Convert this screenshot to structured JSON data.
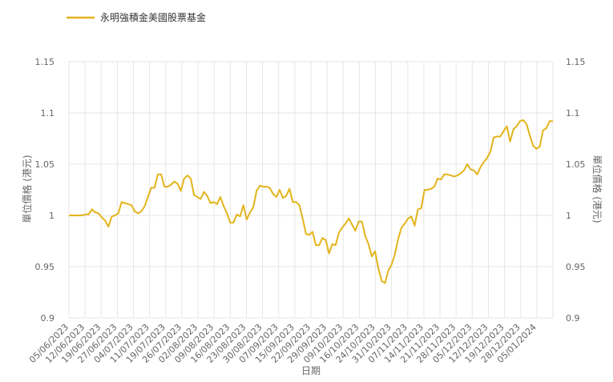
{
  "chart_data": {
    "type": "line",
    "title": "",
    "xlabel": "日期",
    "ylabel_left": "單位價格 (港元)",
    "ylabel_right": "單位價格 (港元)",
    "ylim": [
      0.9,
      1.15
    ],
    "yticks": [
      "0.9",
      "0.95",
      "1",
      "1.05",
      "1.1",
      "1.15"
    ],
    "grid": true,
    "legend_position": "top-left",
    "color": "#E3B41B",
    "x_tick_labels": [
      "05/06/2023",
      "12/06/2023",
      "19/06/2023",
      "27/06/2023",
      "04/07/2023",
      "11/07/2023",
      "19/07/2023",
      "26/07/2023",
      "02/08/2023",
      "09/08/2023",
      "16/08/2023",
      "23/08/2023",
      "30/08/2023",
      "07/09/2023",
      "15/09/2023",
      "22/09/2023",
      "29/09/2023",
      "09/10/2023",
      "16/10/2023",
      "24/10/2023",
      "31/10/2023",
      "07/11/2023",
      "14/11/2023",
      "21/11/2023",
      "28/11/2023",
      "05/12/2023",
      "12/12/2023",
      "19/12/2023",
      "28/12/2023",
      "05/01/2024"
    ],
    "series": [
      {
        "name": "永明強積金美國股票基金",
        "values": [
          1.0,
          1.0,
          1.0,
          1.0,
          1.0,
          1.001,
          1.001,
          1.006,
          1.003,
          1.002,
          0.998,
          0.995,
          0.989,
          0.999,
          1.0,
          1.002,
          1.013,
          1.012,
          1.011,
          1.01,
          1.004,
          1.002,
          1.004,
          1.009,
          1.018,
          1.027,
          1.027,
          1.04,
          1.04,
          1.028,
          1.028,
          1.03,
          1.033,
          1.031,
          1.024,
          1.036,
          1.039,
          1.036,
          1.02,
          1.018,
          1.016,
          1.023,
          1.019,
          1.012,
          1.013,
          1.011,
          1.018,
          1.009,
          1.002,
          0.993,
          0.993,
          1.001,
          0.999,
          1.01,
          0.996,
          1.003,
          1.008,
          1.024,
          1.029,
          1.028,
          1.028,
          1.027,
          1.021,
          1.018,
          1.025,
          1.017,
          1.019,
          1.026,
          1.013,
          1.013,
          1.01,
          0.997,
          0.982,
          0.981,
          0.984,
          0.971,
          0.971,
          0.978,
          0.976,
          0.963,
          0.972,
          0.971,
          0.983,
          0.988,
          0.992,
          0.997,
          0.991,
          0.985,
          0.994,
          0.994,
          0.98,
          0.972,
          0.96,
          0.965,
          0.948,
          0.936,
          0.934,
          0.946,
          0.952,
          0.962,
          0.977,
          0.988,
          0.992,
          0.997,
          0.999,
          0.99,
          1.006,
          1.007,
          1.025,
          1.025,
          1.026,
          1.028,
          1.036,
          1.035,
          1.04,
          1.04,
          1.039,
          1.038,
          1.039,
          1.041,
          1.044,
          1.05,
          1.045,
          1.044,
          1.04,
          1.047,
          1.052,
          1.056,
          1.062,
          1.076,
          1.077,
          1.077,
          1.082,
          1.087,
          1.072,
          1.084,
          1.087,
          1.092,
          1.093,
          1.089,
          1.078,
          1.068,
          1.065,
          1.067,
          1.083,
          1.085,
          1.092,
          1.092
        ]
      }
    ]
  }
}
